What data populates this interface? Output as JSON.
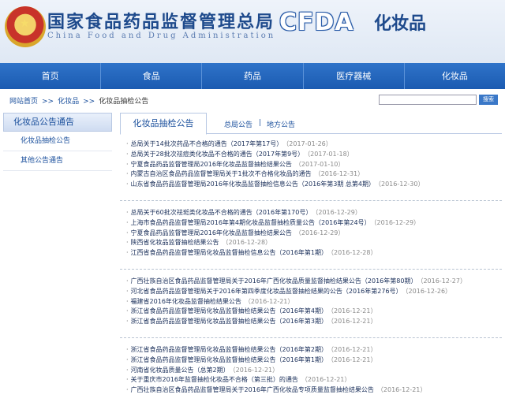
{
  "header": {
    "title_cn": "国家食品药品监督管理总局",
    "title_en": "China Food and Drug Administration",
    "logo_text": "CFDA",
    "section": "化妆品"
  },
  "nav": [
    "首页",
    "食品",
    "药品",
    "医疗器械",
    "化妆品"
  ],
  "breadcrumb": {
    "home": "网站首页",
    "sep": ">>",
    "level1": "化妆品",
    "level2": "化妆品抽检公告"
  },
  "search": {
    "button": "搜索",
    "placeholder": ""
  },
  "sidebar": {
    "title": "化妆品公告通告",
    "items": [
      "化妆品抽检公告",
      "其他公告通告"
    ]
  },
  "tabs": {
    "active": "化妆品抽检公告",
    "link1": "总局公告",
    "pipe": "|",
    "link2": "地方公告"
  },
  "groups": [
    {
      "items": [
        {
          "title": "总局关于14批次药品不合格的通告（2017年第17号）",
          "date": "（2017-01-26）"
        },
        {
          "title": "总局关于28批次祛痘类化妆品不合格的通告（2017年第9号）",
          "date": "（2017-01-18）"
        },
        {
          "title": "宁夏食品药品监督管理局2016年化妆品监督抽检结果公告",
          "date": "（2017-01-10）"
        },
        {
          "title": "内蒙古自治区食品药品监督管理局关于1批次不合格化妆品的通告",
          "date": "（2016-12-31）"
        },
        {
          "title": "山东省食品药品监督管理局2016年化妆品监督抽检信息公告（2016年第3期 总第4期）",
          "date": "（2016-12-30）"
        }
      ]
    },
    {
      "items": [
        {
          "title": "总局关于60批次祛斑类化妆品不合格的通告（2016年第170号）",
          "date": "（2016-12-29）"
        },
        {
          "title": "上海市食品药品监督管理局2016年第4期化妆品监督抽检质量公告（2016年第24号）",
          "date": "（2016-12-29）"
        },
        {
          "title": "宁夏食品药品监督管理局2016年化妆品监督抽检结果公告",
          "date": "（2016-12-29）"
        },
        {
          "title": "陕西省化妆品监督抽检结果公告",
          "date": "（2016-12-28）"
        },
        {
          "title": "江西省食品药品监督管理局化妆品监督抽检信息公告（2016年第1期）",
          "date": "（2016-12-28）"
        }
      ]
    },
    {
      "items": [
        {
          "title": "广西壮族自治区食品药品监督管理局关于2016年广西化妆品质量监督抽检结果公告（2016年第80期）",
          "date": "（2016-12-27）"
        },
        {
          "title": "河北省食品药品监督管理局关于2016年第四季度化妆品监督抽检结果的公告（2016年第276号）",
          "date": "（2016-12-26）"
        },
        {
          "title": "福建省2016年化妆品监督抽检结果公告",
          "date": "（2016-12-21）"
        },
        {
          "title": "浙江省食品药品监督管理局化妆品监督抽检结果公告（2016年第4期）",
          "date": "（2016-12-21）"
        },
        {
          "title": "浙江省食品药品监督管理局化妆品监督抽检结果公告（2016年第3期）",
          "date": "（2016-12-21）"
        }
      ]
    },
    {
      "items": [
        {
          "title": "浙江省食品药品监督管理局化妆品监督抽检结果公告（2016年第2期）",
          "date": "（2016-12-21）"
        },
        {
          "title": "浙江省食品药品监督管理局化妆品监督抽检结果公告（2016年第1期）",
          "date": "（2016-12-21）"
        },
        {
          "title": "河南省化妆品质量公告（总第2期）",
          "date": "（2016-12-21）"
        },
        {
          "title": "关于重庆市2016年监督抽检化妆品不合格（第三批）的通告",
          "date": "（2016-12-21）"
        },
        {
          "title": "广西壮族自治区食品药品监督管理局关于2016年广西化妆品专项质量监督抽检结果公告",
          "date": "（2016-12-21）"
        }
      ]
    }
  ],
  "colors": {
    "nav_bg": "#1f62b8",
    "link": "#1a4f9c",
    "date": "#8a8a8a"
  }
}
